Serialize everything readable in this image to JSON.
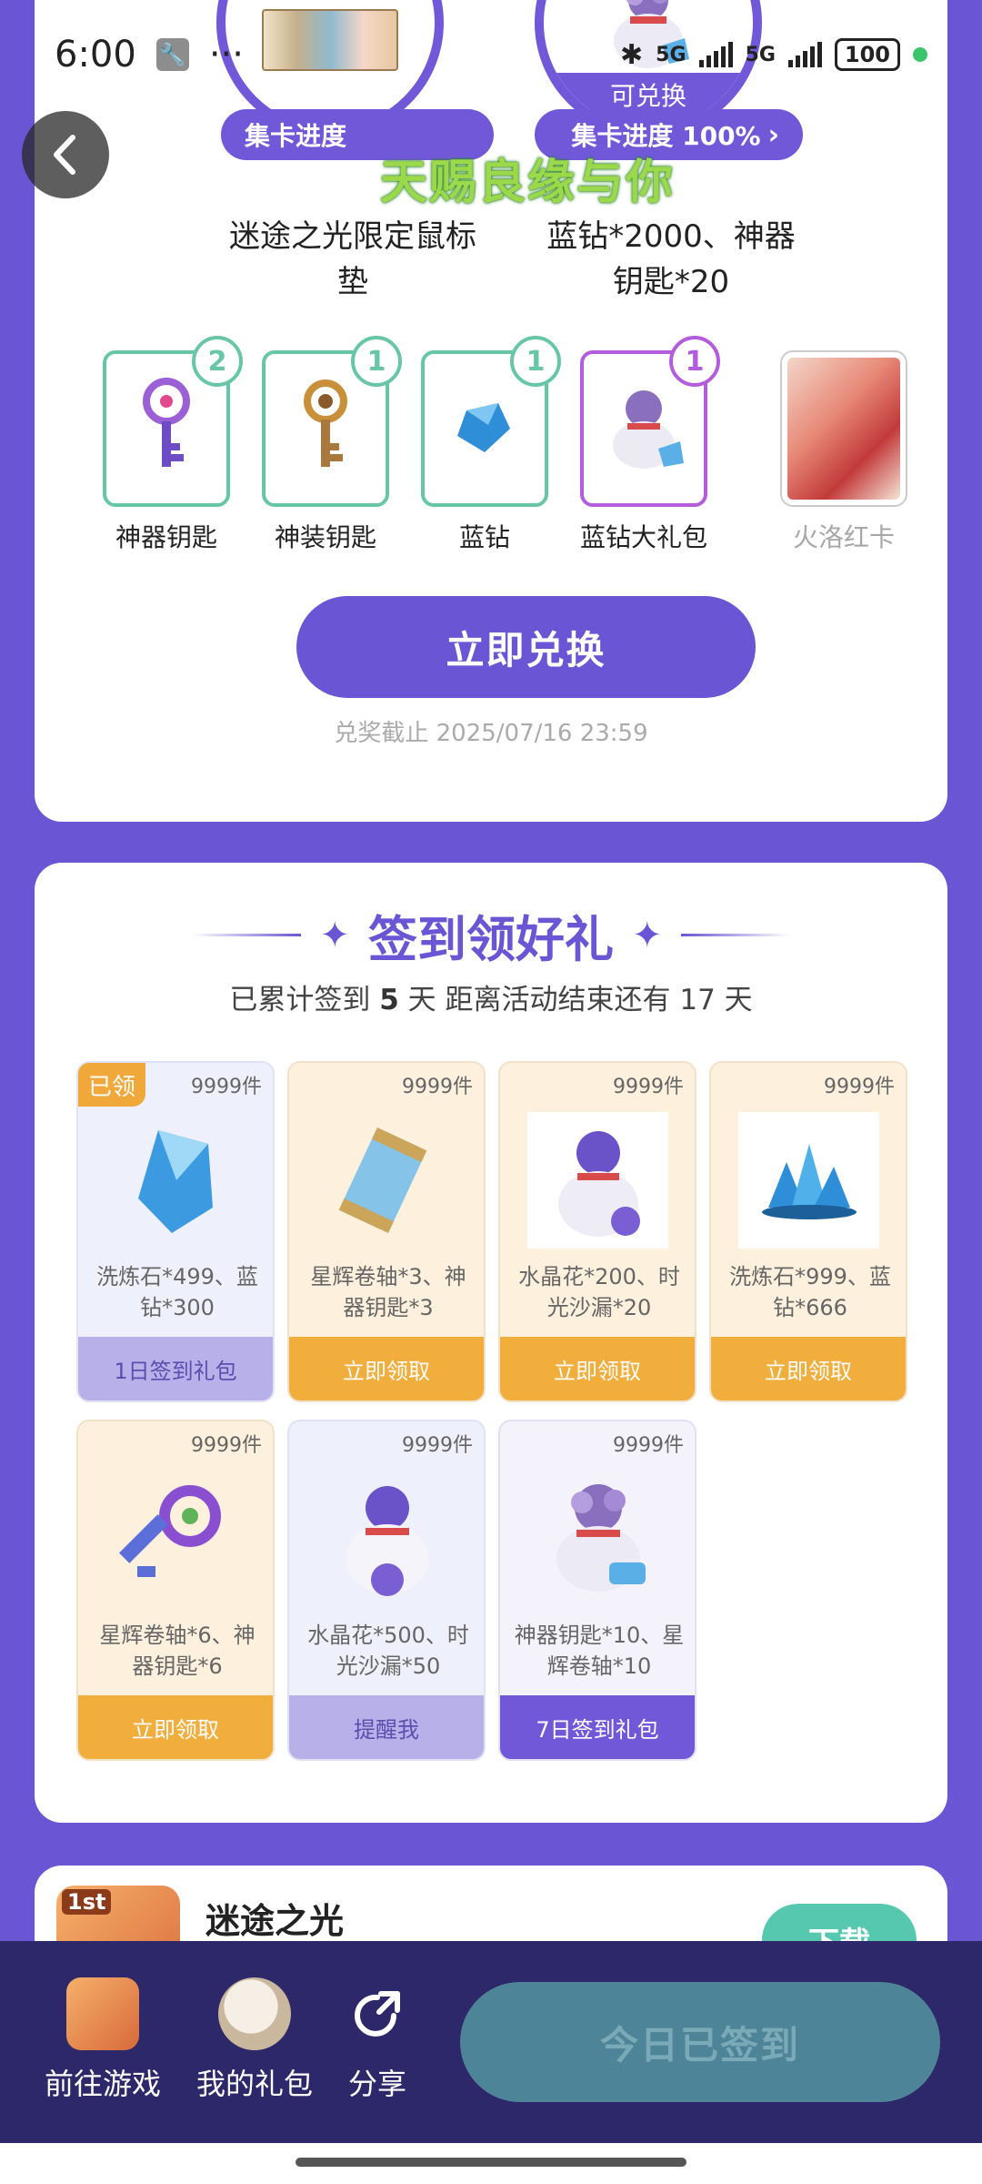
{
  "status_bar": {
    "time": "6:00",
    "dots": "···",
    "network1": "5G",
    "network2": "5G",
    "battery": "100"
  },
  "top_card": {
    "reward1": {
      "progress_label": "集卡进度",
      "name": "迷途之光限定鼠标垫"
    },
    "reward2": {
      "badge": "可兑换",
      "progress_label": "集卡进度 100%",
      "name": "蓝钻*2000、神器钥匙*20"
    },
    "overlay_title": "天赐良缘与你",
    "items": [
      {
        "label": "神器钥匙",
        "count": "2"
      },
      {
        "label": "神装钥匙",
        "count": "1"
      },
      {
        "label": "蓝钻",
        "count": "1"
      },
      {
        "label": "蓝钻大礼包",
        "count": "1"
      },
      {
        "label": "火洛红卡",
        "count": ""
      }
    ],
    "redeem_button": "立即兑换",
    "deadline": "兑奖截止 2025/07/16 23:59"
  },
  "checkin": {
    "title": "签到领好礼",
    "sub_prefix": "已累计签到",
    "days_signed": "5",
    "sub_mid": "天  距离活动结束还有 17 天",
    "gifts": [
      {
        "stock": "9999件",
        "tag": "已领",
        "desc": "洗炼石*499、蓝钻*300",
        "action": "1日签到礼包"
      },
      {
        "stock": "9999件",
        "desc": "星辉卷轴*3、神器钥匙*3",
        "action": "立即领取"
      },
      {
        "stock": "9999件",
        "desc": "水晶花*200、时光沙漏*20",
        "action": "立即领取"
      },
      {
        "stock": "9999件",
        "desc": "洗炼石*999、蓝钻*666",
        "action": "立即领取"
      },
      {
        "stock": "9999件",
        "desc": "星辉卷轴*6、神器钥匙*6",
        "action": "立即领取"
      },
      {
        "stock": "9999件",
        "desc": "水晶花*500、时光沙漏*50",
        "action": "提醒我"
      },
      {
        "stock": "9999件",
        "desc": "神器钥匙*10、星辉卷轴*10",
        "action": "7日签到礼包"
      }
    ]
  },
  "game_card": {
    "icon_badge": "1st",
    "name": "迷途之光",
    "download": "下载"
  },
  "bottom_bar": {
    "go_game": "前往游戏",
    "my_gifts": "我的礼包",
    "share": "分享",
    "signed_button": "今日已签到"
  },
  "colors": {
    "accent": "#6a55d4",
    "teal": "#67c6a6",
    "orange": "#f2ae3d",
    "navy": "#2d2869"
  }
}
